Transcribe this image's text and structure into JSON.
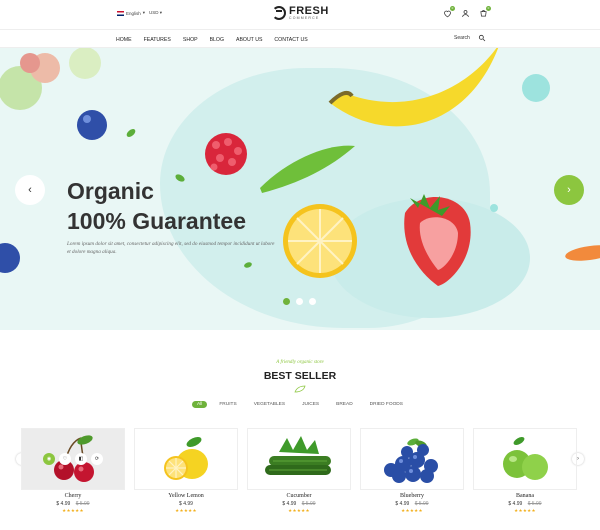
{
  "topbar": {
    "language": "English",
    "currency": "USD",
    "logo_main": "FRESH",
    "logo_sub": "COMMERCE",
    "wishlist_count": "0",
    "cart_count": "0"
  },
  "nav": {
    "items": [
      "HOME",
      "FEATURES",
      "SHOP",
      "BLOG",
      "ABOUT US",
      "CONTACT US"
    ],
    "search_label": "Search"
  },
  "hero": {
    "title_line1": "Organic",
    "title_line2": "100% Guarantee",
    "description": "Lorem ipsum dolor sit amet, consectetur adipiscing elit, sed do eiusmod tempor incididunt ut labore et dolore magna aliqua.",
    "arrow_left": "‹",
    "arrow_right": "›",
    "slide_count": 3,
    "active_slide": 1
  },
  "best_seller": {
    "tagline": "A friendly organic store",
    "title": "BEST SELLER",
    "filters": [
      "All",
      "FRUITS",
      "VEGETABLES",
      "JUICES",
      "BREAD",
      "DRIED FOODS"
    ],
    "active_filter": "All",
    "products": [
      {
        "name": "Cherry",
        "price": "$ 4.99",
        "old_price": "$ 5.99",
        "rating": 5,
        "stars": "★★★★★"
      },
      {
        "name": "Yellow Lemon",
        "price": "$ 4.99",
        "old_price": "",
        "rating": 5,
        "stars": "★★★★★"
      },
      {
        "name": "Cucumber",
        "price": "$ 4.99",
        "old_price": "$ 5.99",
        "rating": 5,
        "stars": "★★★★★"
      },
      {
        "name": "Blueberry",
        "price": "$ 4.99",
        "old_price": "$ 5.99",
        "rating": 5,
        "stars": "★★★★★"
      },
      {
        "name": "Banana",
        "price": "$ 4.99",
        "old_price": "$ 5.99",
        "rating": 5,
        "stars": "★★★★★"
      }
    ]
  },
  "colors": {
    "accent": "#6fb23b",
    "hero_bg": "#e9f7f5",
    "star": "#f2b01e"
  },
  "icons": [
    "wishlist-heart-icon",
    "user-icon",
    "cart-icon",
    "search-icon",
    "chevron-left-icon",
    "chevron-right-icon",
    "eye-icon",
    "heart-icon",
    "compare-icon"
  ]
}
